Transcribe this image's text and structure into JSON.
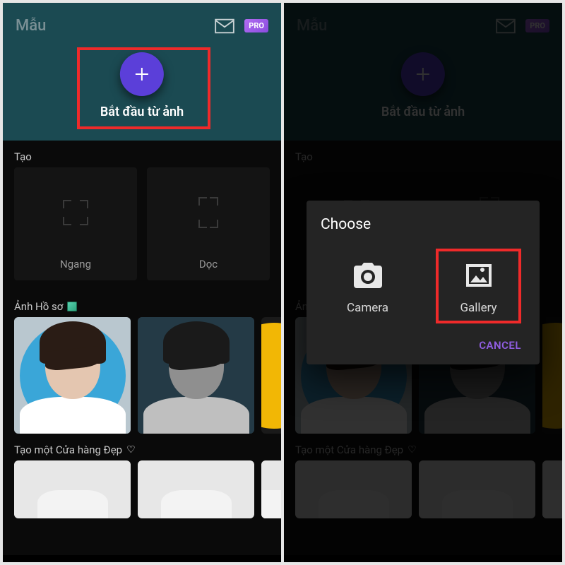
{
  "left": {
    "title": "Mẫu",
    "pro": "PRO",
    "start_label": "Bắt đầu từ ảnh",
    "create_header": "Tạo",
    "create_options": {
      "landscape": "Ngang",
      "portrait": "Dọc"
    },
    "profile_header": "Ảnh Hồ sơ",
    "shop_header": "Tạo một Cửa hàng Đẹp"
  },
  "right": {
    "title": "Mẫu",
    "pro": "PRO",
    "start_label": "Bắt đầu từ ảnh",
    "create_header": "Tạo",
    "profile_header": "Ảnh Hồ sơ",
    "shop_header": "Tạo một Cửa hàng Đẹp",
    "dialog": {
      "title": "Choose",
      "camera": "Camera",
      "gallery": "Gallery",
      "cancel": "CANCEL"
    }
  },
  "highlights": {
    "left_start": true,
    "right_gallery": true
  }
}
